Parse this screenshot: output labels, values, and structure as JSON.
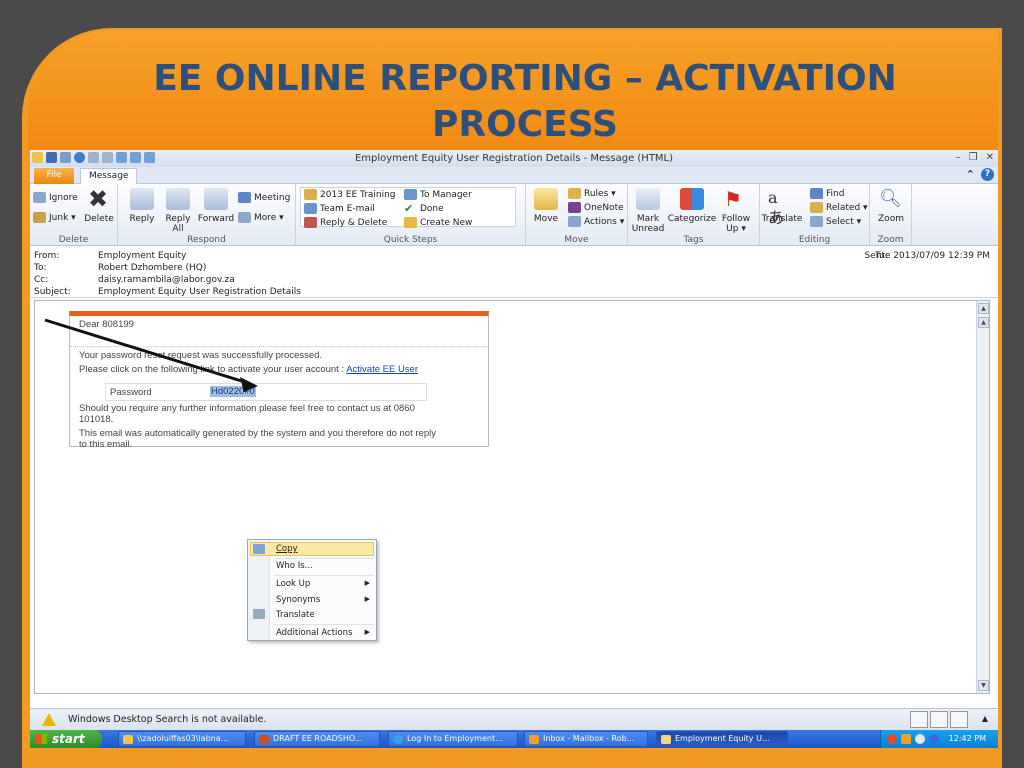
{
  "slide": {
    "title": "EE ONLINE REPORTING – ACTIVATION PROCESS"
  },
  "window": {
    "title": "Employment Equity User Registration Details  -  Message (HTML)",
    "tabs": {
      "file": "File",
      "message": "Message"
    }
  },
  "ribbon": {
    "delete": {
      "label": "Delete",
      "ignore": "Ignore",
      "junk": "Junk ▾",
      "delete_btn": "Delete"
    },
    "respond": {
      "label": "Respond",
      "reply": "Reply",
      "reply_all": "Reply All",
      "forward": "Forward",
      "meeting": "Meeting",
      "more": "More ▾"
    },
    "quick_steps": {
      "label": "Quick Steps",
      "items": [
        "2013 EE Training",
        "Team E-mail",
        "Reply & Delete",
        "To Manager",
        "Done",
        "Create New"
      ]
    },
    "move": {
      "label": "Move",
      "move": "Move",
      "rules": "Rules ▾",
      "onenote": "OneNote",
      "actions": "Actions ▾"
    },
    "tags": {
      "label": "Tags",
      "mark_unread": "Mark Unread",
      "categorize": "Categorize",
      "follow_up": "Follow Up ▾"
    },
    "editing": {
      "label": "Editing",
      "translate": "Translate",
      "find": "Find",
      "related": "Related ▾",
      "select": "Select ▾"
    },
    "zoom": {
      "label": "Zoom",
      "zoom": "Zoom"
    }
  },
  "headers": {
    "from_label": "From:",
    "from": "Employment Equity",
    "to_label": "To:",
    "to": "Robert Dzhombere (HQ)",
    "cc_label": "Cc:",
    "cc": "daisy.ramambila@labor.gov.za",
    "subject_label": "Subject:",
    "subject": "Employment Equity User Registration Details",
    "sent_label": "Sent:",
    "sent": "Tue 2013/07/09 12:39 PM"
  },
  "email": {
    "greeting": "Dear 808199",
    "line1": "Your password reset request was successfully processed.",
    "line2": "Please click on the following link to activate your user account : ",
    "link": "Activate EE User",
    "password_label": "Password",
    "password_value": "Hd0220#0",
    "line3a": "Should you require any further information please feel free to contact us at 0860",
    "line3b": "101018.",
    "line4a": "This email was automatically generated by the system and you therefore do not reply",
    "line4b": "to this email."
  },
  "context_menu": {
    "items": [
      "Copy",
      "Who Is...",
      "Look Up",
      "Synonyms",
      "Translate",
      "Additional Actions"
    ]
  },
  "status": {
    "text": "Windows Desktop Search is not available."
  },
  "taskbar": {
    "start": "start",
    "items": [
      "\\\\zadoluiffas03\\labna...",
      "DRAFT EE ROADSHO...",
      "Log In to Employment...",
      "Inbox - Mailbox - Rob...",
      "Employment Equity U..."
    ],
    "clock": "12:42 PM"
  }
}
